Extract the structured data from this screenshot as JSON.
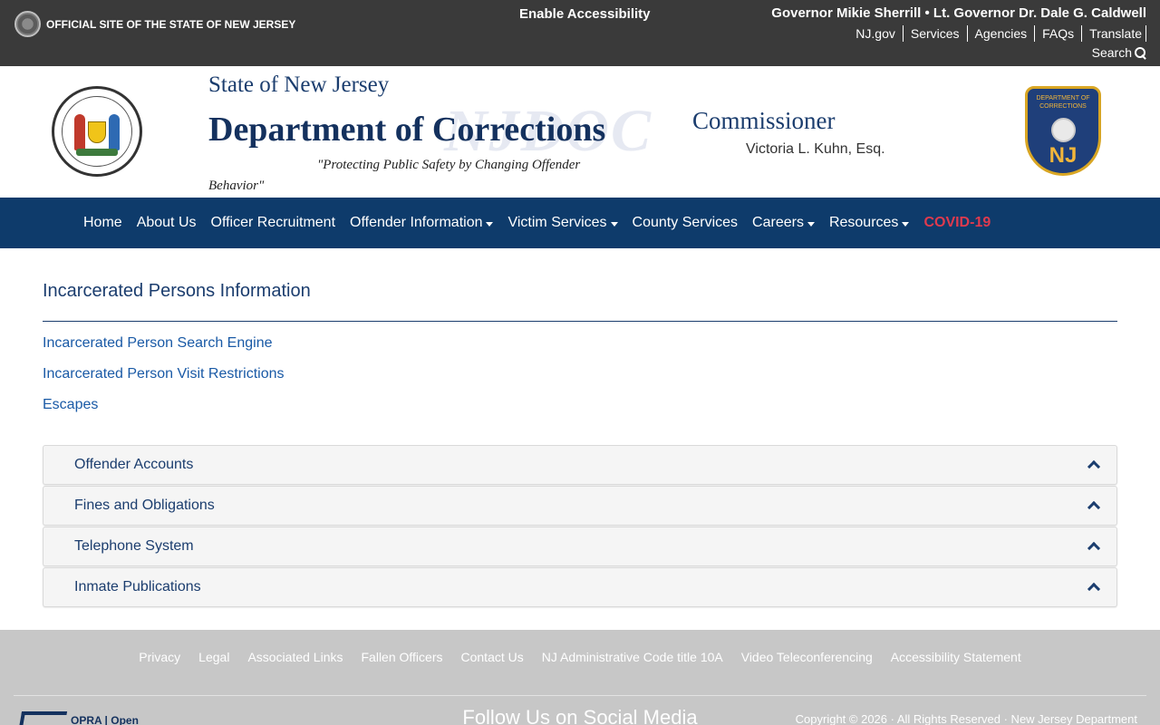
{
  "topbar": {
    "official": "OFFICIAL SITE OF THE STATE OF NEW JERSEY",
    "accessibility": "Enable Accessibility",
    "governor": "Governor Mikie Sherrill • Lt. Governor Dr. Dale G. Caldwell",
    "links": [
      "NJ.gov",
      "Services",
      "Agencies",
      "FAQs",
      "Translate"
    ],
    "search": "Search"
  },
  "header": {
    "state": "State of New Jersey",
    "department": "Department of Corrections",
    "watermark": "NJDOC",
    "tagline": "\"Protecting Public Safety by Changing Offender Behavior\"",
    "commissioner_title": "Commissioner",
    "commissioner_name": "Victoria L. Kuhn, Esq.",
    "badge_top": "DEPARTMENT OF CORRECTIONS",
    "badge_nj": "NJ"
  },
  "nav": {
    "items": [
      {
        "label": "Home",
        "dropdown": false
      },
      {
        "label": "About Us",
        "dropdown": false
      },
      {
        "label": "Officer Recruitment",
        "dropdown": false
      },
      {
        "label": "Offender Information",
        "dropdown": true
      },
      {
        "label": "Victim Services",
        "dropdown": true
      },
      {
        "label": "County Services",
        "dropdown": false
      },
      {
        "label": "Careers",
        "dropdown": true
      },
      {
        "label": "Resources",
        "dropdown": true
      },
      {
        "label": "COVID-19",
        "dropdown": false
      }
    ]
  },
  "main": {
    "title": "Incarcerated Persons Information",
    "links": [
      "Incarcerated Person Search Engine",
      "Incarcerated Person Visit Restrictions",
      "Escapes"
    ],
    "accordion": [
      "Offender Accounts",
      "Fines and Obligations",
      "Telephone System",
      "Inmate Publications"
    ]
  },
  "footer": {
    "links": [
      "Privacy",
      "Legal",
      "Associated Links",
      "Fallen Officers",
      "Contact Us",
      "NJ Administrative Code title 10A",
      "Video Teleconferencing",
      "Accessibility Statement"
    ],
    "opra": "OPRA | Open",
    "follow": "Follow Us on Social Media",
    "copyright": "Copyright © 2026 · All Rights Reserved · New Jersey Department"
  },
  "colors": {
    "topbar": "#3a3a3a",
    "nav": "#0e3b6b",
    "covid": "#e03a4e",
    "link": "#1a5aa6",
    "footer": "#c7c7c7"
  }
}
